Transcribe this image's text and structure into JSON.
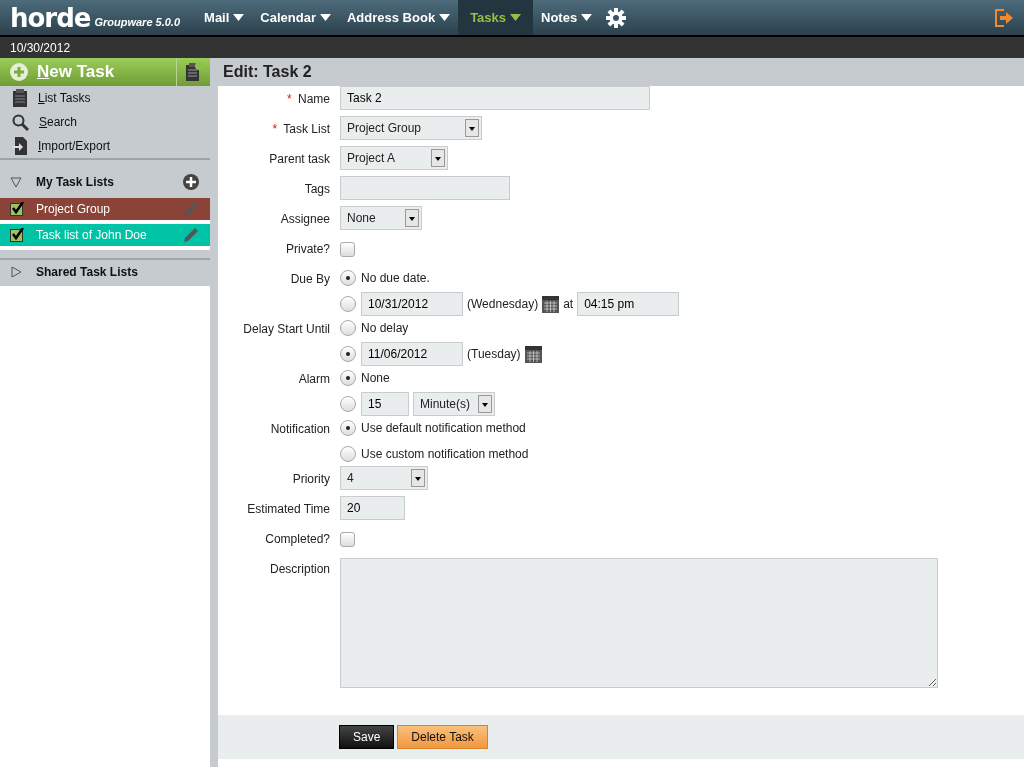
{
  "header": {
    "logo": "horde",
    "product": "Groupware 5.0.0",
    "nav": [
      {
        "label": "Mail",
        "selected": false
      },
      {
        "label": "Calendar",
        "selected": false
      },
      {
        "label": "Address Book",
        "selected": false
      },
      {
        "label": "Tasks",
        "selected": true
      },
      {
        "label": "Notes",
        "selected": false
      }
    ]
  },
  "date": "10/30/2012",
  "sidebar": {
    "new_task": "New Task",
    "links": [
      "List Tasks",
      "Search",
      "Import/Export"
    ],
    "my_lists": {
      "title": "My Task Lists",
      "expanded": true,
      "items": [
        {
          "label": "Project Group",
          "checked": true,
          "color": "#8b4237"
        },
        {
          "label": "Task list of John Doe",
          "checked": true,
          "color": "#00c3a5"
        }
      ]
    },
    "shared_lists": {
      "title": "Shared Task Lists",
      "expanded": false
    }
  },
  "form": {
    "title": "Edit: Task 2",
    "fields": [
      {
        "kind": "text",
        "label": "Name",
        "marker": "*",
        "value": "Task 2"
      },
      {
        "kind": "select",
        "label": "Task List",
        "marker": "*",
        "value": "Project Group"
      },
      {
        "kind": "select",
        "label": "Parent task",
        "value": "Project A"
      },
      {
        "kind": "text",
        "label": "Tags"
      },
      {
        "kind": "select",
        "label": "Assignee",
        "value": "None"
      },
      {
        "kind": "checkbox",
        "label": "Private?",
        "checked": false
      },
      {
        "kind": "radios",
        "label": "Due By",
        "options": [
          {
            "selected": true,
            "parts": [
              {
                "kind": "text",
                "text": "No due date."
              }
            ]
          },
          {
            "selected": false,
            "parts": [
              {
                "kind": "input",
                "value": "10/31/2012"
              },
              {
                "kind": "text",
                "text": "(Wednesday)"
              },
              {
                "kind": "calendar"
              },
              {
                "kind": "text",
                "text": "at"
              },
              {
                "kind": "input",
                "value": "04:15 pm"
              }
            ]
          }
        ]
      },
      {
        "kind": "radios",
        "label": "Delay Start Until",
        "options": [
          {
            "selected": false,
            "parts": [
              {
                "kind": "text",
                "text": "No delay"
              }
            ]
          },
          {
            "selected": true,
            "parts": [
              {
                "kind": "input",
                "value": "11/06/2012"
              },
              {
                "kind": "text",
                "text": "(Tuesday)"
              },
              {
                "kind": "calendar"
              }
            ]
          }
        ]
      },
      {
        "kind": "radios",
        "label": "Alarm",
        "options": [
          {
            "selected": true,
            "parts": [
              {
                "kind": "text",
                "text": "None"
              }
            ]
          },
          {
            "selected": false,
            "parts": [
              {
                "kind": "short",
                "value": "15"
              },
              {
                "kind": "select",
                "value": "Minute(s)"
              }
            ]
          }
        ]
      },
      {
        "kind": "radios",
        "label": "Notification",
        "options": [
          {
            "selected": true,
            "parts": [
              {
                "kind": "text",
                "text": "Use default notification method"
              }
            ]
          },
          {
            "selected": false,
            "parts": [
              {
                "kind": "text",
                "text": "Use custom notification method"
              }
            ]
          }
        ]
      },
      {
        "kind": "select",
        "label": "Priority",
        "value": "4"
      },
      {
        "kind": "text",
        "label": "Estimated Time",
        "value": "20"
      },
      {
        "kind": "checkbox",
        "label": "Completed?",
        "checked": false
      },
      {
        "kind": "textarea",
        "label": "Description"
      }
    ],
    "buttons": [
      {
        "label": "Save",
        "kind": "primary"
      },
      {
        "label": "Delete Task",
        "kind": "danger"
      }
    ]
  }
}
